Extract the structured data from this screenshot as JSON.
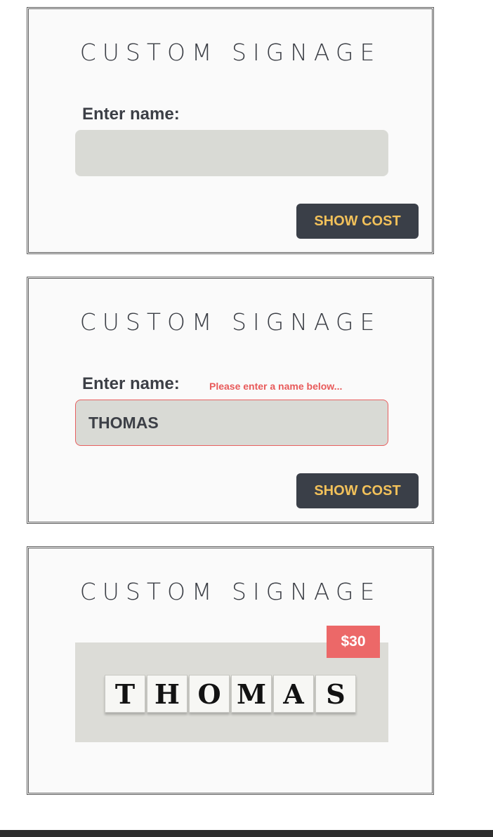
{
  "panels": [
    {
      "title": "CUSTOM SIGNAGE",
      "name_label": "Enter name:",
      "name_value": "",
      "button_label": "SHOW COST"
    },
    {
      "title": "CUSTOM SIGNAGE",
      "name_label": "Enter name:",
      "error_message": "Please enter a name below...",
      "name_value": "THOMAS",
      "button_label": "SHOW COST"
    },
    {
      "title": "CUSTOM SIGNAGE",
      "price": "$30",
      "tiles": [
        "T",
        "H",
        "O",
        "M",
        "A",
        "S"
      ]
    }
  ],
  "colors": {
    "text_dark": "#3c3f46",
    "input_bg": "#d9dad5",
    "error": "#e85a5a",
    "button_bg": "#3a3f48",
    "button_text": "#f2c15a",
    "price_badge_bg": "#ec6868"
  }
}
